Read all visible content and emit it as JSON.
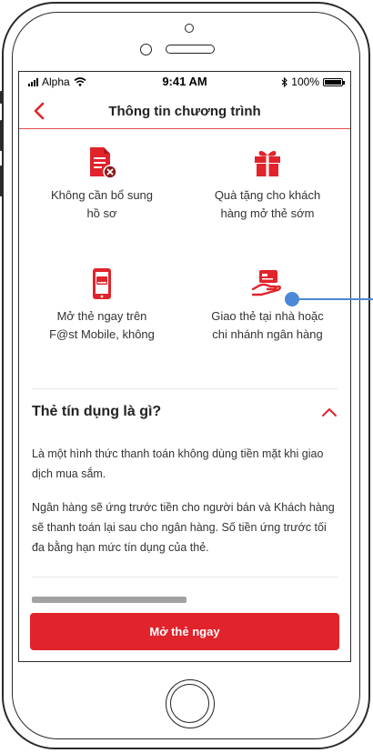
{
  "status_bar": {
    "carrier": "Alpha",
    "time": "9:41 AM",
    "battery": "100%"
  },
  "nav": {
    "title": "Thông tin chương trình"
  },
  "benefits": [
    {
      "line1": "Không cần bổ sung",
      "line2": "hồ sơ",
      "icon": "document-reject-icon"
    },
    {
      "line1": "Quà tặng cho khách",
      "line2": "hàng mở thẻ sớm",
      "icon": "gift-icon"
    },
    {
      "line1": "Mở thẻ ngay trên",
      "line2": "F@st Mobile, không",
      "icon": "mobile-card-icon"
    },
    {
      "line1": "Giao thẻ tại nhà hoặc",
      "line2": "chi nhánh ngân hàng",
      "icon": "card-hand-icon"
    }
  ],
  "faq": {
    "title": "Thẻ tín dụng là gì?",
    "para1": "Là một hình thức thanh toán không dùng tiền mặt khi giao dịch mua sắm.",
    "para2": "Ngân hàng sẽ ứng trước tiền cho người bán và Khách hàng sẽ thanh toán lại sau cho ngân hàng. Số tiền ứng trước tối đa bằng hạn mức tín dụng của thẻ."
  },
  "cta": {
    "label": "Mở thẻ ngay"
  },
  "colors": {
    "brand_red": "#e1232b",
    "hotspot_blue": "#4b88d6"
  }
}
